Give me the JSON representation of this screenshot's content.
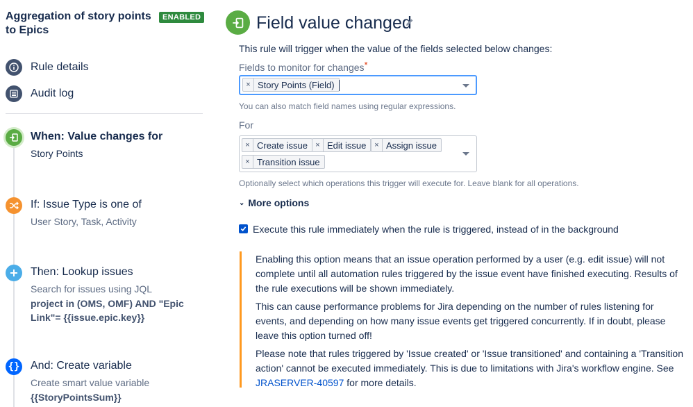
{
  "sidebar": {
    "rule_title": "Aggregation of story points to Epics",
    "status_badge": "ENABLED",
    "links": [
      {
        "label": "Rule details",
        "icon": "info-icon"
      },
      {
        "label": "Audit log",
        "icon": "list-icon"
      }
    ],
    "steps": [
      {
        "title": "When: Value changes for",
        "subtitle": "Story Points",
        "icon": "field-trigger-icon",
        "color": "#5aac44"
      },
      {
        "title": "If: Issue Type is one of",
        "subtitle": "User Story, Task, Activity",
        "icon": "shuffle-icon",
        "color": "#f5922f"
      },
      {
        "title": "Then: Lookup issues",
        "subtitle": "Search for issues using JQL",
        "code": "project in (OMS, OMF) AND \"Epic Link\"= {{issue.epic.key}}",
        "icon": "plus-icon",
        "color": "#4bade8"
      },
      {
        "title": "And: Create variable",
        "subtitle": "Create smart value variable",
        "code": "{{StoryPointsSum}}",
        "icon": "curly-braces-icon",
        "color": "#0065ff"
      }
    ]
  },
  "main": {
    "title": "Field value changed",
    "description": "This rule will trigger when the value of the fields selected below changes:",
    "fields_label": "Fields to monitor for changes",
    "required_mark": "*",
    "fields_selected": [
      "Story Points (Field)"
    ],
    "fields_help": "You can also match field names using regular expressions.",
    "for_label": "For",
    "for_selected": [
      "Create issue",
      "Edit issue",
      "Assign issue",
      "Transition issue"
    ],
    "for_help": "Optionally select which operations this trigger will execute for. Leave blank for all operations.",
    "more_options": "More options",
    "checkbox_label": "Execute this rule immediately when the rule is triggered, instead of in the background",
    "checkbox_checked": true,
    "note": {
      "p1": "Enabling this option means that an issue operation performed by a user (e.g. edit issue) will not complete until all automation rules triggered by the issue event have finished executing. Results of the rule executions will be shown immediately.",
      "p2": "This can cause performance problems for Jira depending on the number of rules listening for events, and depending on how many issue events get triggered concurrently. If in doubt, please leave this option turned off!",
      "p3": "Please note that rules triggered by 'Issue created' or 'Issue transitioned' and containing a 'Transition action' cannot be executed immediately. This is due to limitations with Jira's workflow engine. See",
      "link": "JRASERVER-40597",
      "p3_end": "for more details."
    }
  },
  "colors": {
    "badge": "#2e8a3e",
    "accent": "#0052cc",
    "warning": "#ff991f"
  }
}
